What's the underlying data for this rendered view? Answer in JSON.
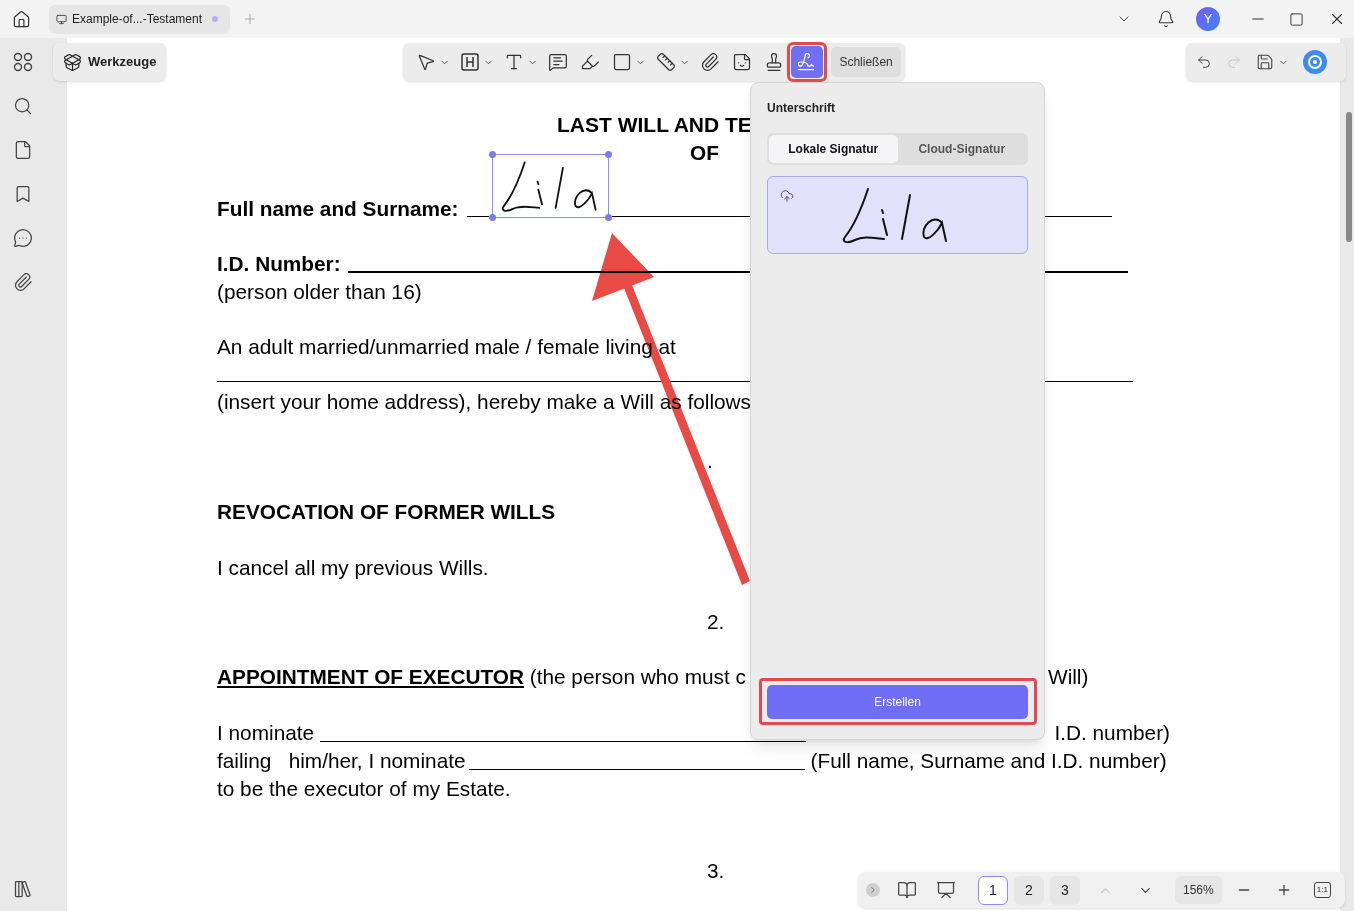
{
  "tabs": [
    {
      "label": "Example-of...-Testament",
      "selected": true
    }
  ],
  "tools_button": "Werkzeuge",
  "avatar": "Y",
  "toolbar": {
    "tools": [
      {
        "kind": "select",
        "dropdown": true,
        "selected": false,
        "highlighted": false
      },
      {
        "kind": "heading",
        "dropdown": true,
        "selected": false,
        "highlighted": false
      },
      {
        "kind": "text",
        "dropdown": true,
        "selected": false,
        "highlighted": false
      },
      {
        "kind": "comment",
        "dropdown": false,
        "selected": false,
        "highlighted": false
      },
      {
        "kind": "highlight",
        "dropdown": false,
        "selected": false,
        "highlighted": false
      },
      {
        "kind": "shape",
        "dropdown": true,
        "selected": false,
        "highlighted": false
      },
      {
        "kind": "measure",
        "dropdown": true,
        "selected": false,
        "highlighted": false
      },
      {
        "kind": "attach",
        "dropdown": false,
        "selected": false,
        "highlighted": false
      },
      {
        "kind": "sticker",
        "dropdown": false,
        "selected": false,
        "highlighted": false
      },
      {
        "kind": "stamp",
        "dropdown": false,
        "selected": false,
        "highlighted": false
      },
      {
        "kind": "signature",
        "dropdown": false,
        "selected": true,
        "highlighted": true
      }
    ],
    "close_button": "Schließen",
    "redo_disabled": true
  },
  "signature_panel": {
    "title": "Unterschrift",
    "tabs": [
      {
        "label": "Lokale Signatur",
        "selected": true
      },
      {
        "label": "Cloud-Signatur",
        "selected": false
      }
    ],
    "create_button": "Erstellen",
    "create_highlighted": true
  },
  "document": {
    "lines": [
      {
        "kind": "title",
        "text": "LAST WILL AND TE"
      },
      {
        "kind": "subtitle",
        "text": "OF"
      },
      {
        "kind": "signature_field",
        "label": "Full name and Surname:"
      },
      {
        "kind": "field",
        "label": "I.D. Number:"
      },
      {
        "kind": "text",
        "text": "(person older than 16)"
      },
      {
        "kind": "text",
        "text": "An adult married/unmarried male / female living at"
      },
      {
        "kind": "rule"
      },
      {
        "kind": "text",
        "text": "(insert your home address), hereby make a Will as follows"
      },
      {
        "kind": "number",
        "text": "."
      },
      {
        "kind": "heading",
        "text": "REVOCATION OF FORMER WILLS"
      },
      {
        "kind": "text",
        "text": "I cancel all my previous Wills."
      },
      {
        "kind": "number",
        "text": "2."
      },
      {
        "kind": "appointment",
        "heading": "APPOINTMENT OF EXECUTOR",
        "text": " (the person who must c",
        "right": "Will)"
      },
      {
        "kind": "nominate",
        "text": "I nominate",
        "right": "I.D. number)"
      },
      {
        "kind": "blank_inline",
        "text": "failing   him/her, I nominate",
        "right": "(Full name, Surname and I.D. number)"
      },
      {
        "kind": "text",
        "text": "to be the executor of my Estate."
      },
      {
        "kind": "number",
        "text": "3."
      }
    ]
  },
  "bottom_bar": {
    "pages": [
      {
        "label": "1",
        "selected": true
      },
      {
        "label": "2",
        "selected": false
      },
      {
        "label": "3",
        "selected": false
      }
    ],
    "prev_disabled": true,
    "zoom": "156%",
    "actual_size": "1:1"
  }
}
